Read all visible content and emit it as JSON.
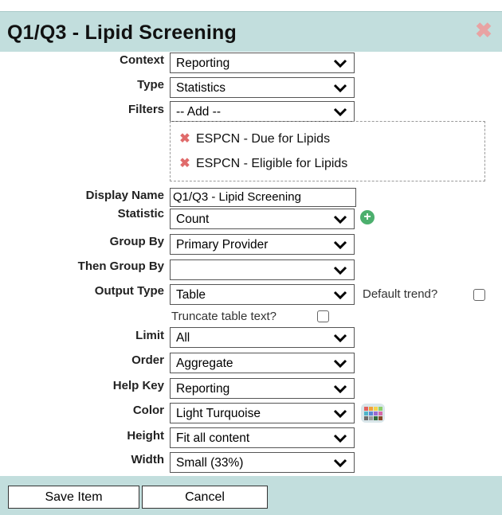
{
  "header": {
    "title": "Q1/Q3 - Lipid Screening"
  },
  "labels": {
    "context": "Context",
    "type": "Type",
    "filters": "Filters",
    "display_name": "Display Name",
    "statistic": "Statistic",
    "group_by": "Group By",
    "then_group_by": "Then Group By",
    "output_type": "Output Type",
    "limit": "Limit",
    "order": "Order",
    "help_key": "Help Key",
    "color": "Color",
    "height": "Height",
    "width": "Width"
  },
  "fields": {
    "context": "Reporting",
    "type": "Statistics",
    "filters_add": "-- Add --",
    "display_name": "Q1/Q3 - Lipid Screening",
    "statistic": "Count",
    "group_by": "Primary Provider",
    "then_group_by": "",
    "output_type": "Table",
    "limit": "All",
    "order": "Aggregate",
    "help_key": "Reporting",
    "color": "Light Turquoise",
    "height": "Fit all content",
    "width": "Small (33%)"
  },
  "filters": [
    {
      "label": "ESPCN - Due for Lipids"
    },
    {
      "label": "ESPCN - Eligible for Lipids"
    }
  ],
  "checkboxes": {
    "default_trend": "Default trend?",
    "truncate_text": "Truncate table text?"
  },
  "buttons": {
    "save": "Save Item",
    "cancel": "Cancel"
  },
  "colors": {
    "header_bg": "#c2dedd",
    "remove_icon": "#e06b6b",
    "add_icon": "#4caf6d"
  }
}
